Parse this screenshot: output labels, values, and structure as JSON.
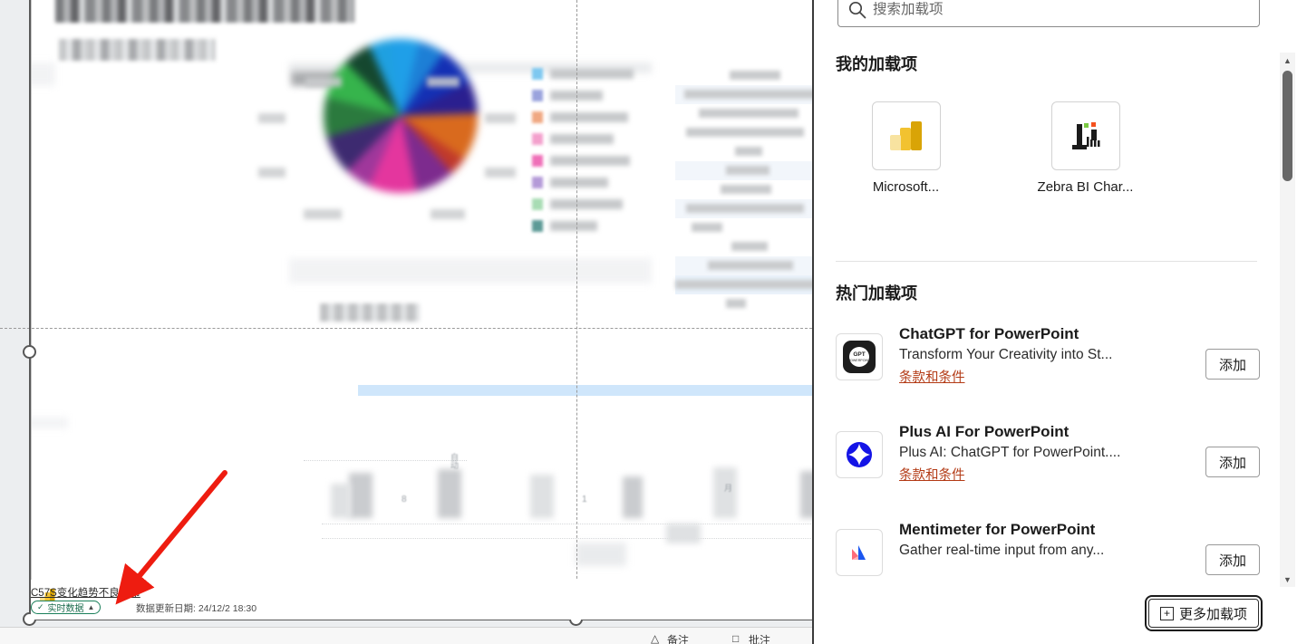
{
  "slide": {
    "status_bar": {
      "report_title": "C57S变化趋势不良分布",
      "badge_label": "实时数据",
      "badge_check_icon": "check-circle-icon",
      "badge_chevron_icon": "chevron-up-icon",
      "update_label": "数据更新日期: 24/12/2 18:30",
      "powerbi_icon": "power-bi-icon"
    },
    "bottom_toolbar": {
      "notes_label": "备注",
      "comments_label": "批注",
      "notes_icon": "notes-icon",
      "comments_icon": "comment-icon"
    },
    "chart_tick_labels": [
      "8",
      "1"
    ],
    "annotation_arrow_icon": "red-arrow-annotation"
  },
  "pane": {
    "search": {
      "placeholder": "搜索加载项",
      "value": "",
      "icon": "search-icon"
    },
    "my_addins": {
      "heading": "我的加载项",
      "items": [
        {
          "name": "Microsoft...",
          "icon": "power-bi-icon"
        },
        {
          "name": "Zebra BI Char...",
          "icon": "zebra-bi-icon"
        }
      ]
    },
    "popular_addins": {
      "heading": "热门加载项",
      "add_label": "添加",
      "terms_label": "条款和条件",
      "items": [
        {
          "title": "ChatGPT for PowerPoint",
          "description": "Transform Your Creativity into St...",
          "terms": "条款和条件",
          "add": "添加",
          "icon": "chatgpt-powerpoint-icon"
        },
        {
          "title": "Plus AI For PowerPoint",
          "description": "Plus AI: ChatGPT for PowerPoint....",
          "terms": "条款和条件",
          "add": "添加",
          "icon": "plus-ai-icon"
        },
        {
          "title": "Mentimeter for PowerPoint",
          "description": "Gather real-time input from any...",
          "terms": "",
          "add": "添加",
          "icon": "mentimeter-icon"
        }
      ]
    },
    "more_button": {
      "label": "更多加载项",
      "icon": "plus-box-icon"
    },
    "scrollbar": {
      "up_icon": "scroll-up-arrow",
      "down_icon": "scroll-down-arrow"
    }
  },
  "colors": {
    "terms_link": "#b33a15",
    "badge_green": "#1a7f5a",
    "annotation_red": "#ee1c10",
    "highlight_blue": "#cfe6fb",
    "accent_blue": "#2b88d8"
  }
}
